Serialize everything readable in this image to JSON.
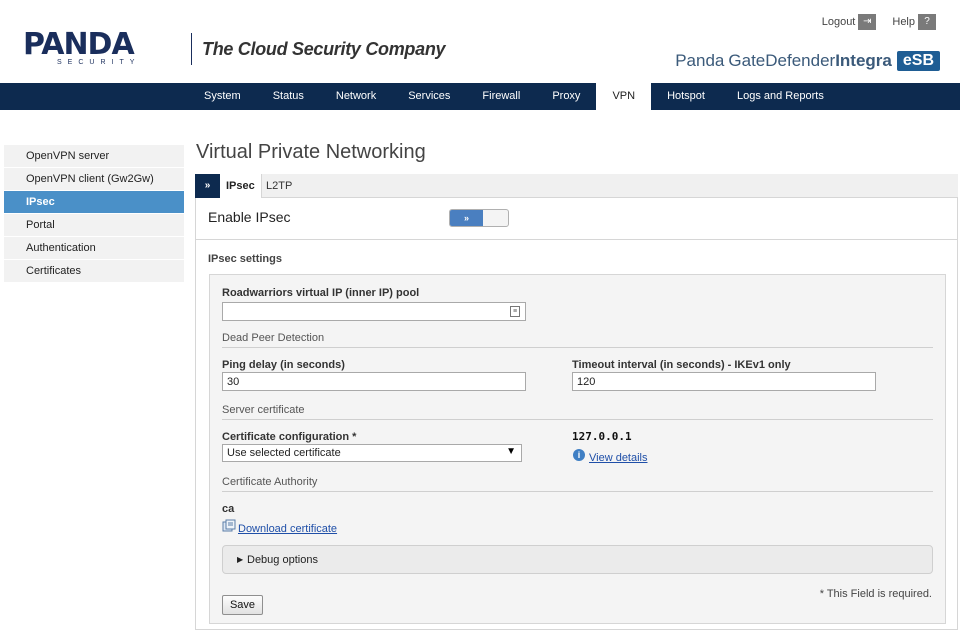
{
  "header": {
    "logo_word": "PANDA",
    "logo_sub": "SECURITY",
    "tagline": "The Cloud Security Company",
    "logout_label": "Logout",
    "help_label": "Help",
    "product_brand": "Panda",
    "product_name_a": "GateDefender",
    "product_name_b": "Integra",
    "product_badge": "eSB"
  },
  "nav": {
    "items": [
      "System",
      "Status",
      "Network",
      "Services",
      "Firewall",
      "Proxy",
      "VPN",
      "Hotspot",
      "Logs and Reports"
    ],
    "active": "VPN"
  },
  "sidebar": {
    "items": [
      "OpenVPN server",
      "OpenVPN client (Gw2Gw)",
      "IPsec",
      "Portal",
      "Authentication",
      "Certificates"
    ],
    "active": "IPsec"
  },
  "main": {
    "title": "Virtual Private Networking",
    "tab_chevron": "»",
    "tabs": [
      "IPsec",
      "L2TP"
    ],
    "enable_label": "Enable IPsec",
    "toggle_glyph": "»",
    "settings_title": "IPsec settings",
    "pool_label": "Roadwarriors virtual IP (inner IP) pool",
    "pool_value": "",
    "dpd_section": "Dead Peer Detection",
    "ping_label": "Ping delay (in seconds)",
    "ping_value": "30",
    "timeout_label": "Timeout interval (in seconds) - IKEv1 only",
    "timeout_value": "120",
    "server_cert_section": "Server certificate",
    "cert_config_label": "Certificate configuration *",
    "cert_config_selected": "Use selected certificate",
    "cert_ip": "127.0.0.1",
    "view_details": "View details",
    "ca_section": "Certificate Authority",
    "ca_name": "ca",
    "download_cert": "Download certificate",
    "debug_label": "Debug options",
    "required_note": "* This Field is required.",
    "save_label": "Save"
  },
  "colors": {
    "nav_bg": "#0d2a4f",
    "sidebar_active": "#4a90c8",
    "brand_blue": "#1a2e5c",
    "esb_badge": "#1f5d94"
  }
}
